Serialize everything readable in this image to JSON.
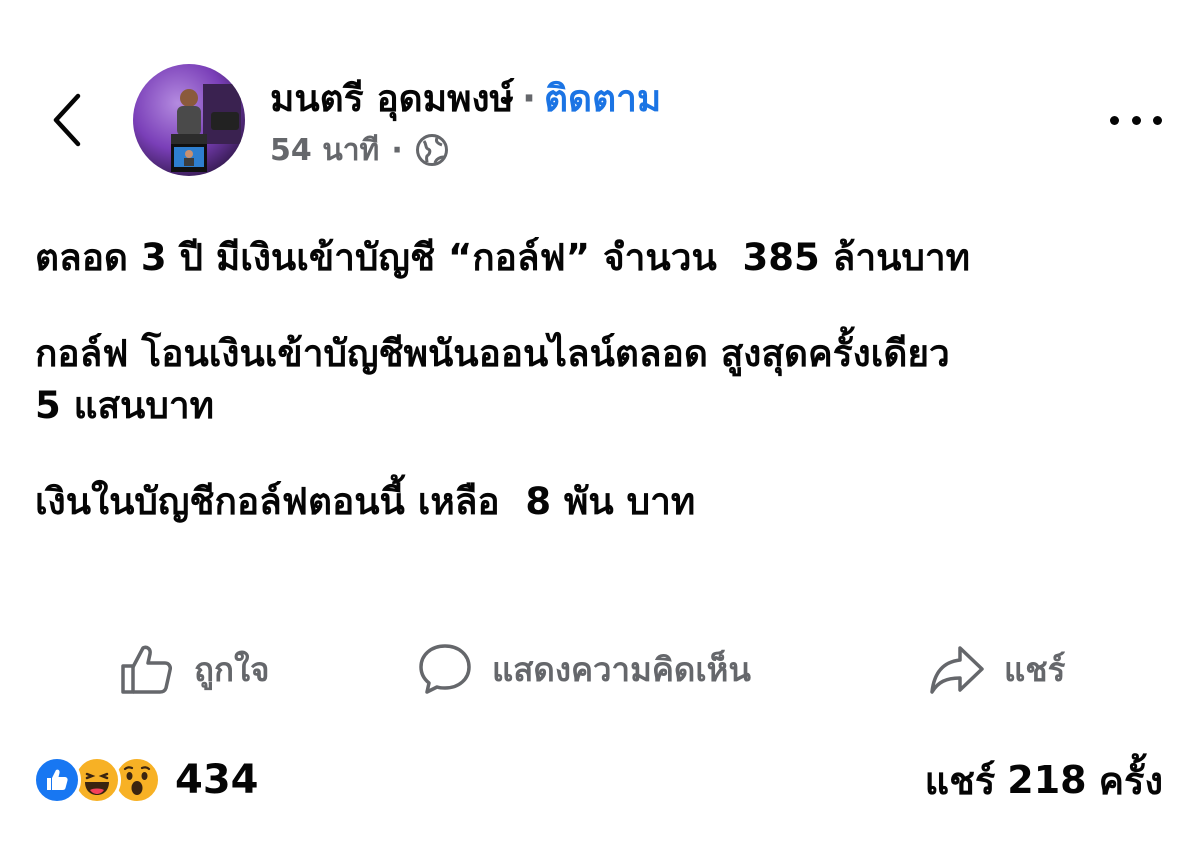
{
  "header": {
    "author_name": "มนตรี อุดมพงษ์",
    "separator": "·",
    "follow_label": "ติดตาม",
    "time": "54 นาที",
    "meta_separator": "·",
    "privacy_icon": "globe-icon",
    "back_icon": "chevron-left-icon",
    "more_icon": "more-horizontal-icon"
  },
  "post": {
    "paragraphs": [
      "ตลอด 3 ปี มีเงินเข้าบัญชี “กอล์ฟ” จำนวน  385 ล้านบาท",
      "กอล์ฟ โอนเงินเข้าบัญชีพนันออนไลน์ตลอด สูงสุดครั้งเดียว\n5 แสนบาท",
      "เงินในบัญชีกอล์ฟตอนนี้ เหลือ  8 พัน บาท"
    ]
  },
  "actions": {
    "like_label": "ถูกใจ",
    "comment_label": "แสดงความคิดเห็น",
    "share_label": "แชร์"
  },
  "stats": {
    "reactions": [
      "like-icon",
      "haha-icon",
      "wow-icon"
    ],
    "reaction_count": "434",
    "shares_prefix": "แชร์",
    "shares_count": "218",
    "shares_suffix": "ครั้ง"
  },
  "colors": {
    "text": "#050505",
    "secondary": "#65676b",
    "link": "#1b74e4",
    "like_blue": "#1877f2",
    "emoji_yellow": "#f7b125"
  }
}
